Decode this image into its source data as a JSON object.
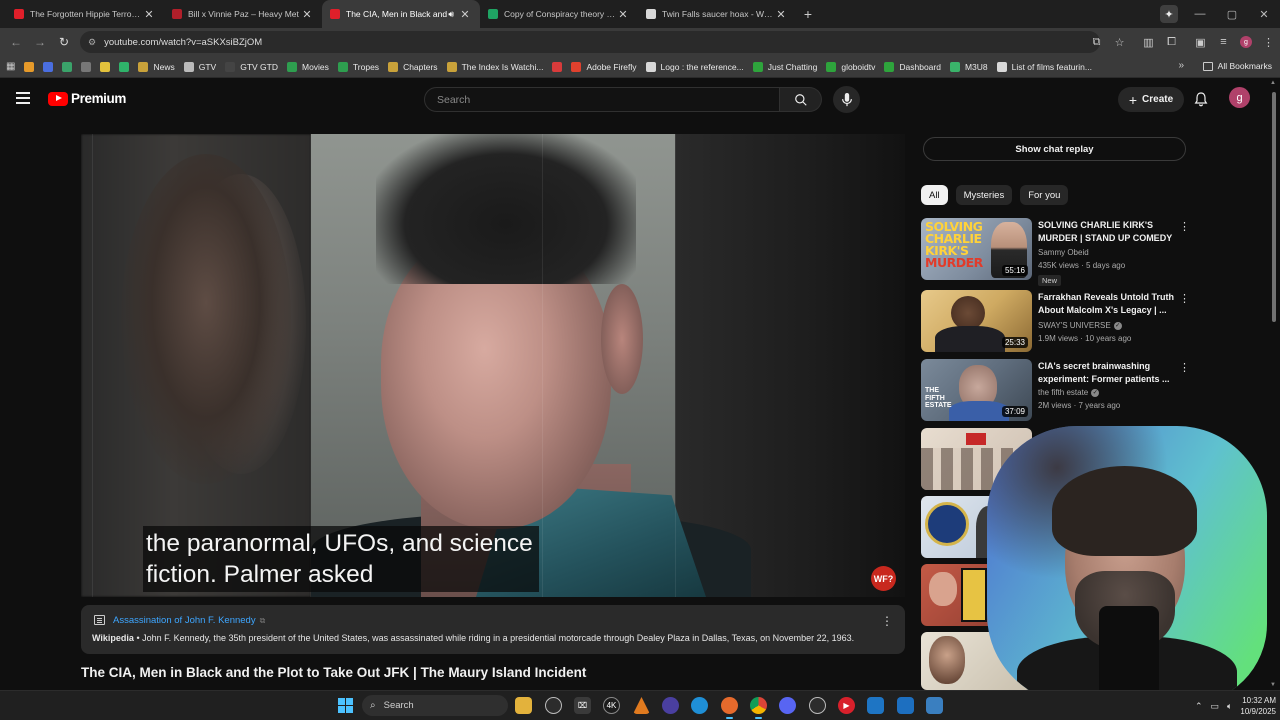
{
  "browser": {
    "tabs": [
      {
        "title": "The Forgotten Hippie Terror Cu",
        "favicon_color": "#e01f2a",
        "active": false
      },
      {
        "title": "Bill x Vinnie Paz – Heavy Met",
        "favicon_color": "#b11f2a",
        "active": false
      },
      {
        "title": "The CIA, Men in Black and",
        "favicon_color": "#e01f2a",
        "active": true
      },
      {
        "title": "Copy of Conspiracy theory / tro",
        "favicon_color": "#1fa463",
        "active": false
      },
      {
        "title": "Twin Falls saucer hoax - Wikipe",
        "favicon_color": "#d8d8d8",
        "active": false
      }
    ],
    "url": "youtube.com/watch?v=aSKXsiBZjOM",
    "bookmarks": [
      {
        "label": "",
        "color": "#e69a2a"
      },
      {
        "label": "",
        "color": "#4a6ee0"
      },
      {
        "label": "",
        "color": "#3aa36a"
      },
      {
        "label": "",
        "color": "#777777"
      },
      {
        "label": "",
        "color": "#e3c23c"
      },
      {
        "label": "",
        "color": "#2fb36a"
      },
      {
        "label": "News",
        "color": "#c9a23a"
      },
      {
        "label": "GTV",
        "color": "#bbbbbb"
      },
      {
        "label": "GTV GTD",
        "color": "#444444"
      },
      {
        "label": "Movies",
        "color": "#2e9e4f"
      },
      {
        "label": "Tropes",
        "color": "#2e9e4f"
      },
      {
        "label": "Chapters",
        "color": "#c9a23a"
      },
      {
        "label": "The Index Is Watchi...",
        "color": "#c9a23a"
      },
      {
        "label": "",
        "color": "#d83b3b"
      },
      {
        "label": "Adobe Firefly",
        "color": "#e0412e"
      },
      {
        "label": "Logo : the reference...",
        "color": "#d8d8d8"
      },
      {
        "label": "Just Chatting",
        "color": "#2ea43c"
      },
      {
        "label": "globoidtv",
        "color": "#2ea43c"
      },
      {
        "label": "Dashboard",
        "color": "#2ea43c"
      },
      {
        "label": "M3U8",
        "color": "#3ab36a"
      },
      {
        "label": "List of films featurin...",
        "color": "#d8d8d8"
      }
    ],
    "all_bookmarks": "All Bookmarks"
  },
  "youtube": {
    "logo_text": "Premium",
    "search_placeholder": "Search",
    "create_label": "Create",
    "avatar_letter": "g",
    "caption_lines": [
      "the paranormal, UFOs, and science",
      "fiction. Palmer asked"
    ],
    "channel_badge": "WF?",
    "info_panel": {
      "topic": "Assassination of John F. Kennedy",
      "source": "Wikipedia",
      "text": " • John F. Kennedy, the 35th president of the United States, was assassinated while riding in a presidential motorcade through Dealey Plaza in Dallas, Texas, on November 22, 1963."
    },
    "video_title": "The CIA, Men in Black and the Plot to Take Out JFK | The Maury Island Incident",
    "chat_replay": "Show chat replay",
    "chips": [
      "All",
      "Mysteries",
      "For you"
    ],
    "recommendations": [
      {
        "title": "SOLVING CHARLIE KIRK'S MURDER | STAND UP COMEDY",
        "channel": "Sammy Obeid",
        "verified": false,
        "views": "435K views",
        "age": "5 days ago",
        "duration": "55:16",
        "badge": "New",
        "thumb_text_lines": [
          "SOLVING",
          "CHARLIE",
          "KIRK'S",
          "MURDER"
        ]
      },
      {
        "title": "Farrakhan Reveals Untold Truth About Malcolm X's Legacy | ...",
        "channel": "SWAY'S UNIVERSE",
        "verified": true,
        "views": "1.9M views",
        "age": "10 years ago",
        "duration": "25:33",
        "badge": "",
        "thumb_text_lines": []
      },
      {
        "title": "CIA's secret brainwashing experiment: Former patients ...",
        "channel": "the fifth estate",
        "verified": true,
        "views": "2M views",
        "age": "7 years ago",
        "duration": "37:09",
        "badge": "",
        "thumb_text_lines": [
          "THE",
          "FIFTH",
          "ESTATE"
        ]
      }
    ]
  },
  "taskbar": {
    "search_label": "Search",
    "time": "10:32 AM",
    "date": "10/9/2025"
  }
}
